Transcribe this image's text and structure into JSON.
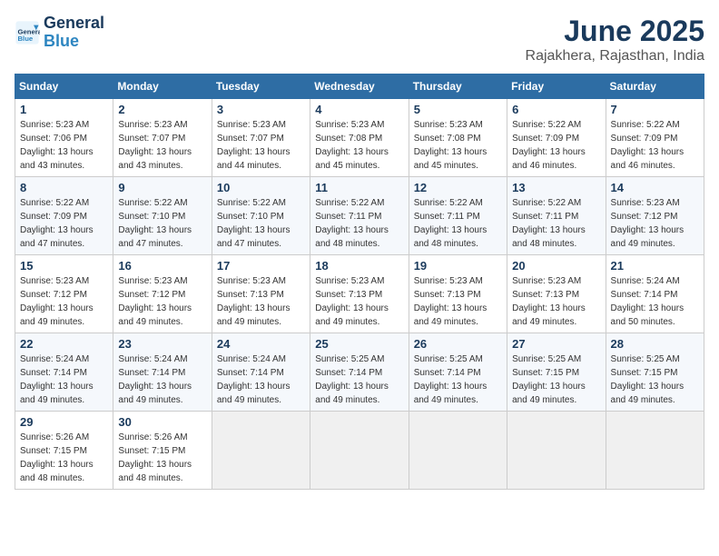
{
  "header": {
    "logo_line1": "General",
    "logo_line2": "Blue",
    "month_title": "June 2025",
    "location": "Rajakhera, Rajasthan, India"
  },
  "calendar": {
    "days_of_week": [
      "Sunday",
      "Monday",
      "Tuesday",
      "Wednesday",
      "Thursday",
      "Friday",
      "Saturday"
    ],
    "weeks": [
      [
        null,
        {
          "day": "2",
          "sunrise": "5:23 AM",
          "sunset": "7:07 PM",
          "daylight": "13 hours and 43 minutes."
        },
        {
          "day": "3",
          "sunrise": "5:23 AM",
          "sunset": "7:07 PM",
          "daylight": "13 hours and 44 minutes."
        },
        {
          "day": "4",
          "sunrise": "5:23 AM",
          "sunset": "7:08 PM",
          "daylight": "13 hours and 45 minutes."
        },
        {
          "day": "5",
          "sunrise": "5:23 AM",
          "sunset": "7:08 PM",
          "daylight": "13 hours and 45 minutes."
        },
        {
          "day": "6",
          "sunrise": "5:22 AM",
          "sunset": "7:09 PM",
          "daylight": "13 hours and 46 minutes."
        },
        {
          "day": "7",
          "sunrise": "5:22 AM",
          "sunset": "7:09 PM",
          "daylight": "13 hours and 46 minutes."
        }
      ],
      [
        {
          "day": "1",
          "sunrise": "5:23 AM",
          "sunset": "7:06 PM",
          "daylight": "13 hours and 43 minutes."
        },
        null,
        null,
        null,
        null,
        null,
        null
      ],
      [
        {
          "day": "8",
          "sunrise": "5:22 AM",
          "sunset": "7:09 PM",
          "daylight": "13 hours and 47 minutes."
        },
        {
          "day": "9",
          "sunrise": "5:22 AM",
          "sunset": "7:10 PM",
          "daylight": "13 hours and 47 minutes."
        },
        {
          "day": "10",
          "sunrise": "5:22 AM",
          "sunset": "7:10 PM",
          "daylight": "13 hours and 47 minutes."
        },
        {
          "day": "11",
          "sunrise": "5:22 AM",
          "sunset": "7:11 PM",
          "daylight": "13 hours and 48 minutes."
        },
        {
          "day": "12",
          "sunrise": "5:22 AM",
          "sunset": "7:11 PM",
          "daylight": "13 hours and 48 minutes."
        },
        {
          "day": "13",
          "sunrise": "5:22 AM",
          "sunset": "7:11 PM",
          "daylight": "13 hours and 48 minutes."
        },
        {
          "day": "14",
          "sunrise": "5:23 AM",
          "sunset": "7:12 PM",
          "daylight": "13 hours and 49 minutes."
        }
      ],
      [
        {
          "day": "15",
          "sunrise": "5:23 AM",
          "sunset": "7:12 PM",
          "daylight": "13 hours and 49 minutes."
        },
        {
          "day": "16",
          "sunrise": "5:23 AM",
          "sunset": "7:12 PM",
          "daylight": "13 hours and 49 minutes."
        },
        {
          "day": "17",
          "sunrise": "5:23 AM",
          "sunset": "7:13 PM",
          "daylight": "13 hours and 49 minutes."
        },
        {
          "day": "18",
          "sunrise": "5:23 AM",
          "sunset": "7:13 PM",
          "daylight": "13 hours and 49 minutes."
        },
        {
          "day": "19",
          "sunrise": "5:23 AM",
          "sunset": "7:13 PM",
          "daylight": "13 hours and 49 minutes."
        },
        {
          "day": "20",
          "sunrise": "5:23 AM",
          "sunset": "7:13 PM",
          "daylight": "13 hours and 49 minutes."
        },
        {
          "day": "21",
          "sunrise": "5:24 AM",
          "sunset": "7:14 PM",
          "daylight": "13 hours and 50 minutes."
        }
      ],
      [
        {
          "day": "22",
          "sunrise": "5:24 AM",
          "sunset": "7:14 PM",
          "daylight": "13 hours and 49 minutes."
        },
        {
          "day": "23",
          "sunrise": "5:24 AM",
          "sunset": "7:14 PM",
          "daylight": "13 hours and 49 minutes."
        },
        {
          "day": "24",
          "sunrise": "5:24 AM",
          "sunset": "7:14 PM",
          "daylight": "13 hours and 49 minutes."
        },
        {
          "day": "25",
          "sunrise": "5:25 AM",
          "sunset": "7:14 PM",
          "daylight": "13 hours and 49 minutes."
        },
        {
          "day": "26",
          "sunrise": "5:25 AM",
          "sunset": "7:14 PM",
          "daylight": "13 hours and 49 minutes."
        },
        {
          "day": "27",
          "sunrise": "5:25 AM",
          "sunset": "7:15 PM",
          "daylight": "13 hours and 49 minutes."
        },
        {
          "day": "28",
          "sunrise": "5:25 AM",
          "sunset": "7:15 PM",
          "daylight": "13 hours and 49 minutes."
        }
      ],
      [
        {
          "day": "29",
          "sunrise": "5:26 AM",
          "sunset": "7:15 PM",
          "daylight": "13 hours and 48 minutes."
        },
        {
          "day": "30",
          "sunrise": "5:26 AM",
          "sunset": "7:15 PM",
          "daylight": "13 hours and 48 minutes."
        },
        null,
        null,
        null,
        null,
        null
      ]
    ]
  }
}
